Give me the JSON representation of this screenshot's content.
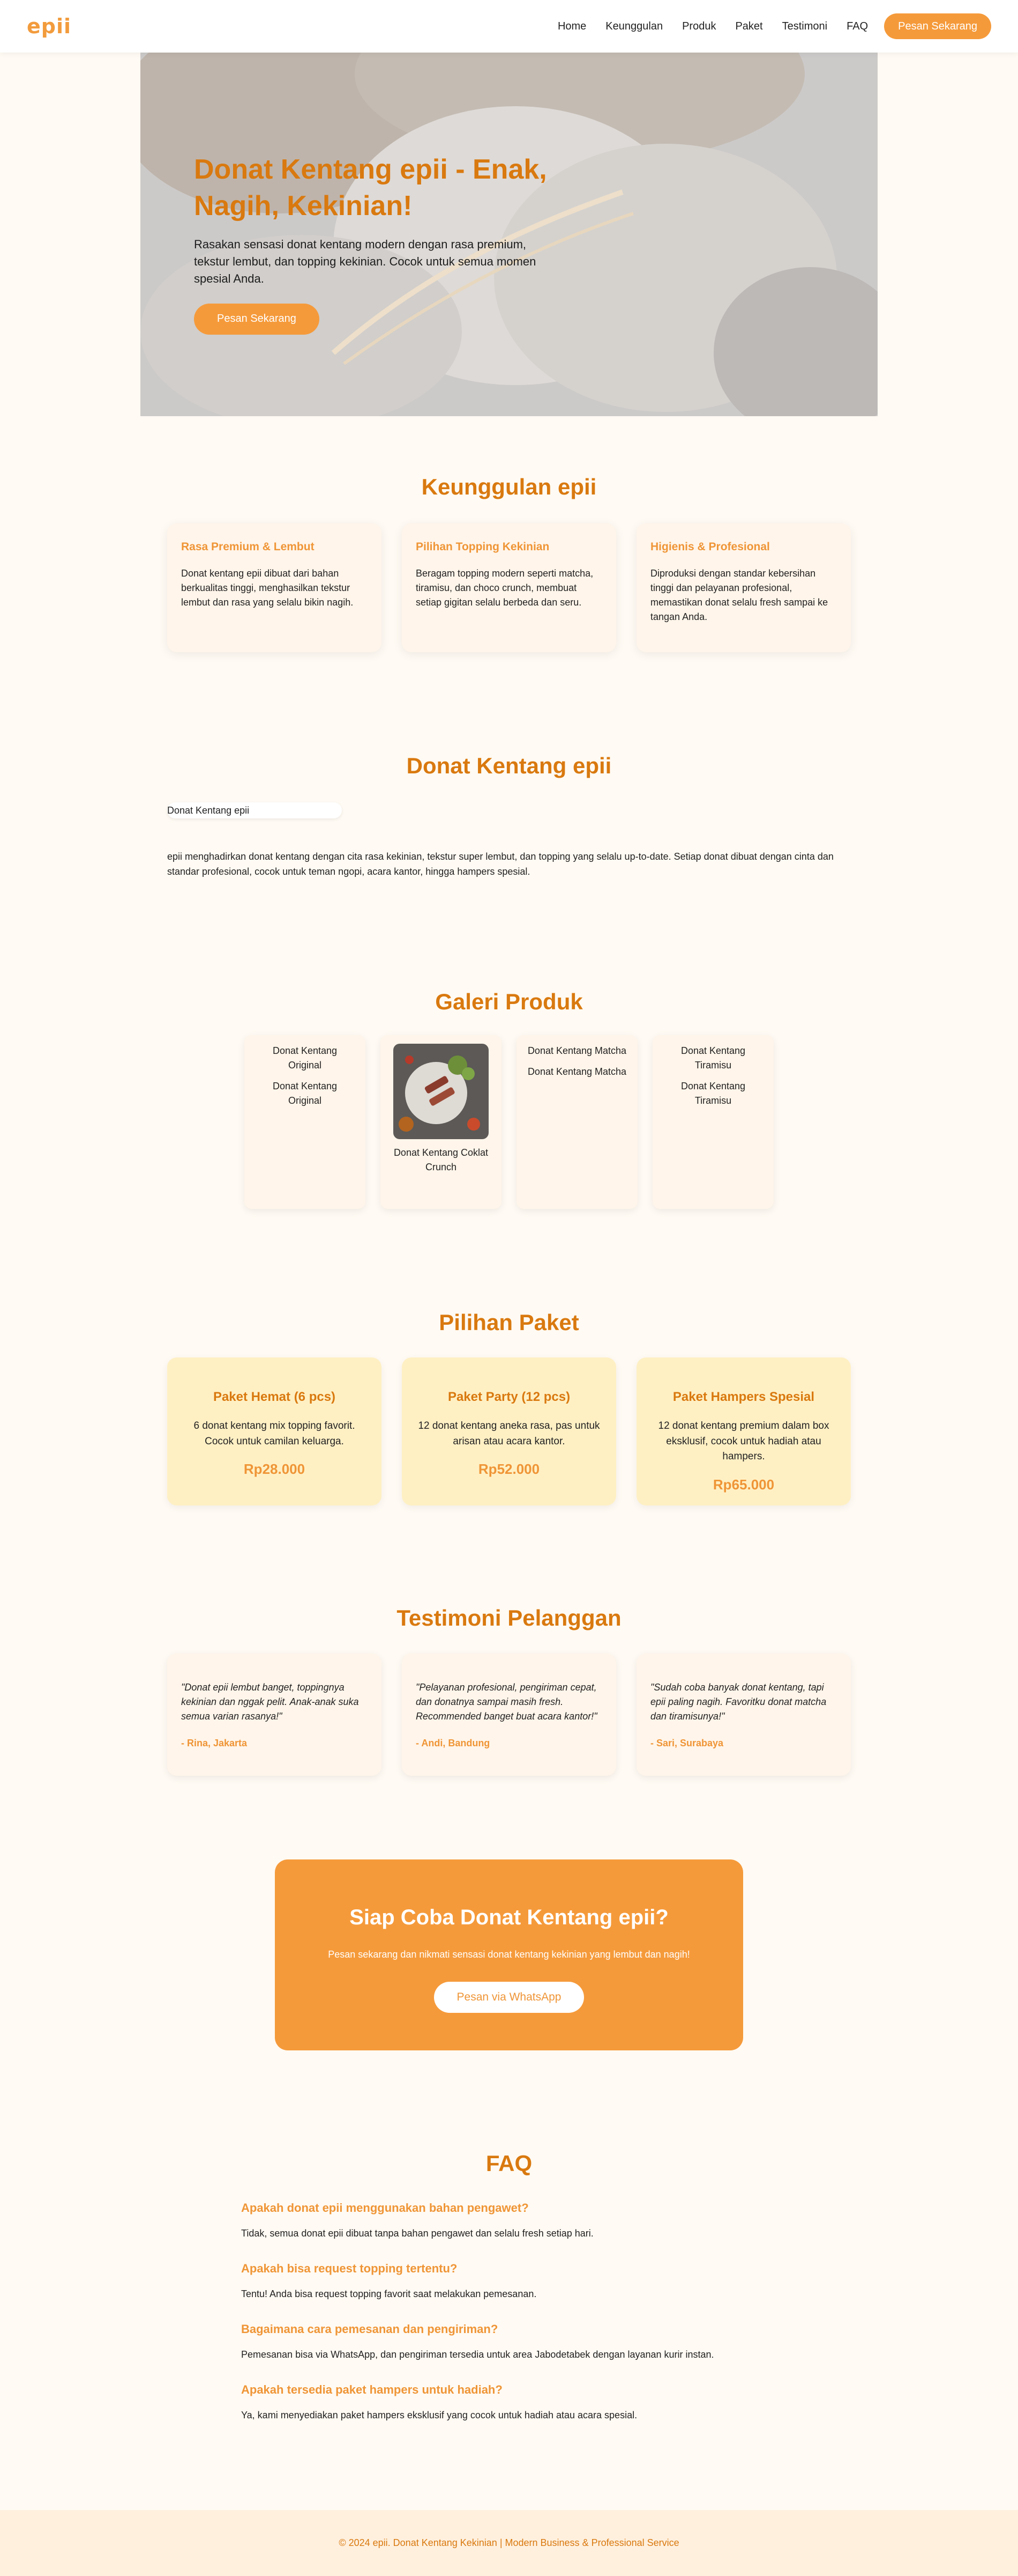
{
  "brand": {
    "logo": "epii",
    "accent": "#f59a3a",
    "title_color": "#d9790f"
  },
  "nav": {
    "items": [
      "Home",
      "Keunggulan",
      "Produk",
      "Paket",
      "Testimoni",
      "FAQ"
    ],
    "cta": "Pesan Sekarang"
  },
  "hero": {
    "title": "Donat Kentang epii - Enak, Nagih, Kekinian!",
    "text": "Rasakan sensasi donat kentang modern dengan rasa premium, tekstur lembut, dan topping kekinian. Cocok untuk semua momen spesial Anda.",
    "button": "Pesan Sekarang"
  },
  "features": {
    "title": "Keunggulan epii",
    "items": [
      {
        "title": "Rasa Premium & Lembut",
        "text": "Donat kentang epii dibuat dari bahan berkualitas tinggi, menghasilkan tekstur lembut dan rasa yang selalu bikin nagih."
      },
      {
        "title": "Pilihan Topping Kekinian",
        "text": "Beragam topping modern seperti matcha, tiramisu, dan choco crunch, membuat setiap gigitan selalu berbeda dan seru."
      },
      {
        "title": "Higienis & Profesional",
        "text": "Diproduksi dengan standar kebersihan tinggi dan pelayanan profesional, memastikan donat selalu fresh sampai ke tangan Anda."
      }
    ]
  },
  "about": {
    "title": "Donat Kentang epii",
    "image_alt": "Donat Kentang epii",
    "text": "epii menghadirkan donat kentang dengan cita rasa kekinian, tekstur super lembut, dan topping yang selalu up-to-date. Setiap donat dibuat dengan cinta dan standar profesional, cocok untuk teman ngopi, acara kantor, hingga hampers spesial."
  },
  "gallery": {
    "title": "Galeri Produk",
    "items": [
      {
        "alt": "Donat Kentang Original",
        "name": "Donat Kentang Original"
      },
      {
        "alt": "",
        "name": "Donat Kentang Coklat Crunch"
      },
      {
        "alt": "Donat Kentang Matcha",
        "name": "Donat Kentang Matcha"
      },
      {
        "alt": "Donat Kentang Tiramisu",
        "name": "Donat Kentang Tiramisu"
      }
    ]
  },
  "packages": {
    "title": "Pilihan Paket",
    "items": [
      {
        "name": "Paket Hemat (6 pcs)",
        "desc": "6 donat kentang mix topping favorit. Cocok untuk camilan keluarga.",
        "price": "Rp28.000"
      },
      {
        "name": "Paket Party (12 pcs)",
        "desc": "12 donat kentang aneka rasa, pas untuk arisan atau acara kantor.",
        "price": "Rp52.000"
      },
      {
        "name": "Paket Hampers Spesial",
        "desc": "12 donat kentang premium dalam box eksklusif, cocok untuk hadiah atau hampers.",
        "price": "Rp65.000"
      }
    ]
  },
  "testimonials": {
    "title": "Testimoni Pelanggan",
    "items": [
      {
        "quote": "\"Donat epii lembut banget, toppingnya kekinian dan nggak pelit. Anak-anak suka semua varian rasanya!\"",
        "author": "- Rina, Jakarta"
      },
      {
        "quote": "\"Pelayanan profesional, pengiriman cepat, dan donatnya sampai masih fresh. Recommended banget buat acara kantor!\"",
        "author": "- Andi, Bandung"
      },
      {
        "quote": "\"Sudah coba banyak donat kentang, tapi epii paling nagih. Favoritku donat matcha dan tiramisunya!\"",
        "author": "- Sari, Surabaya"
      }
    ]
  },
  "cta": {
    "title": "Siap Coba Donat Kentang epii?",
    "text": "Pesan sekarang dan nikmati sensasi donat kentang kekinian yang lembut dan nagih!",
    "button": "Pesan via WhatsApp"
  },
  "faq": {
    "title": "FAQ",
    "items": [
      {
        "q": "Apakah donat epii menggunakan bahan pengawet?",
        "a": "Tidak, semua donat epii dibuat tanpa bahan pengawet dan selalu fresh setiap hari."
      },
      {
        "q": "Apakah bisa request topping tertentu?",
        "a": "Tentu! Anda bisa request topping favorit saat melakukan pemesanan."
      },
      {
        "q": "Bagaimana cara pemesanan dan pengiriman?",
        "a": "Pemesanan bisa via WhatsApp, dan pengiriman tersedia untuk area Jabodetabek dengan layanan kurir instan."
      },
      {
        "q": "Apakah tersedia paket hampers untuk hadiah?",
        "a": "Ya, kami menyediakan paket hampers eksklusif yang cocok untuk hadiah atau acara spesial."
      }
    ]
  },
  "footer": {
    "text": "© 2024 epii. Donat Kentang Kekinian | Modern Business & Professional Service"
  }
}
